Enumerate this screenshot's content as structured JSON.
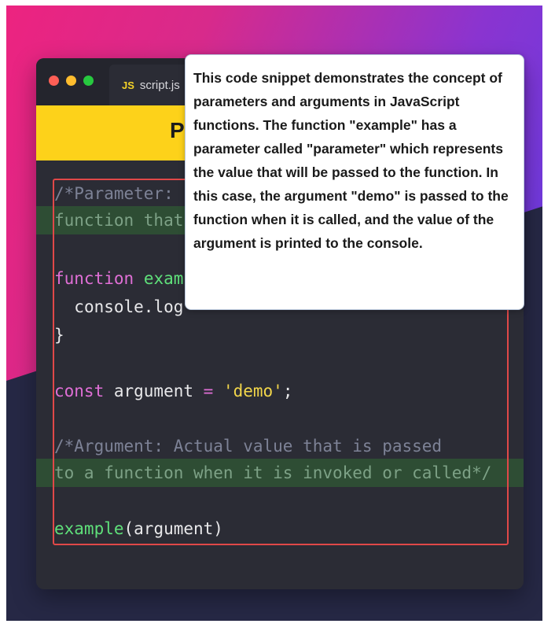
{
  "editor": {
    "tab_lang": "JS",
    "tab_name": "script.js",
    "banner_title_visible": "P"
  },
  "code": {
    "line1": "/*Parameter: ",
    "line2": "function that",
    "line3_kw": "function",
    "line3_fn": "exam",
    "line4": "console.log",
    "line5": "}",
    "line6_kw": "const",
    "line6_var": " argument ",
    "line6_op": "=",
    "line6_str": "'demo'",
    "line6_end": ";",
    "line7": "/*Argument: Actual value that is passed",
    "line8": "to a function when it is invoked or called*/",
    "line9_fn": "example",
    "line9_rest": "(argument)"
  },
  "tooltip": {
    "text": "This code snippet demonstrates the concept of parameters and arguments in JavaScript functions. The function \"example\" has a parameter called \"parameter\" which represents the value that will be passed to the function. In this case, the argument \"demo\" is passed to the function when it is called, and the value of the argument is printed to the console."
  },
  "colors": {
    "keyword": "#e06fd6",
    "function": "#5fe07a",
    "string": "#f2d64a",
    "comment": "#7d8296",
    "highlight": "#2e4d34",
    "frame": "#e04848",
    "banner": "#fdd21a"
  }
}
